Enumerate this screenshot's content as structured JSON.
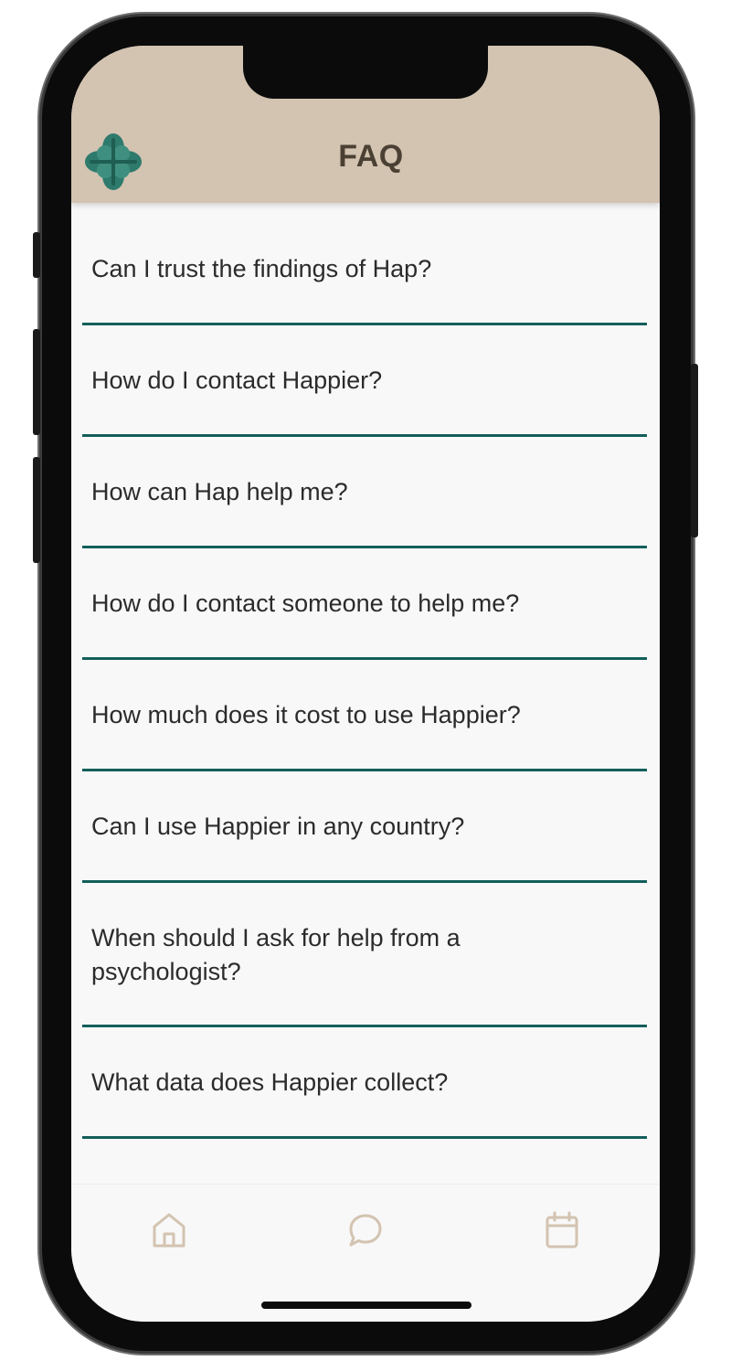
{
  "header": {
    "title": "FAQ",
    "logo_icon": "clover-logo-icon",
    "background_color": "#d3c3b1",
    "logo_color": "#2e7a6c"
  },
  "faq": {
    "divider_color": "#135e5a",
    "items": [
      {
        "question": "Can I trust the findings of Hap?"
      },
      {
        "question": "How do I contact Happier?"
      },
      {
        "question": "How can Hap help me?"
      },
      {
        "question": "How do I contact someone to help me?"
      },
      {
        "question": "How much does it cost to use Happier?"
      },
      {
        "question": "Can I use Happier in any country?"
      },
      {
        "question": "When should I ask for help from a psychologist?"
      },
      {
        "question": "What data does Happier collect?"
      }
    ]
  },
  "tabbar": {
    "icon_color": "#d3c3b1",
    "tabs": [
      {
        "icon": "home-icon"
      },
      {
        "icon": "chat-bubble-icon"
      },
      {
        "icon": "calendar-icon"
      }
    ]
  }
}
